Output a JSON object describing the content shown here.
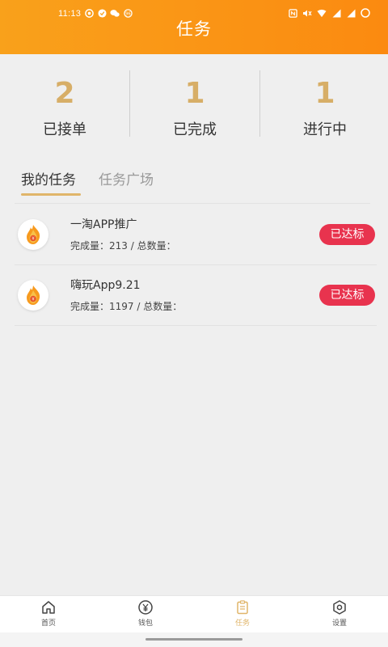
{
  "status_bar": {
    "time": "11:13",
    "left_icons": [
      "notification-app-icon",
      "shield-notification-icon",
      "wechat-icon",
      "app-badge-icon"
    ],
    "right_icons": [
      "nfc-icon",
      "mute-icon",
      "wifi-icon",
      "signal-icon",
      "signal-icon",
      "battery-icon"
    ]
  },
  "header": {
    "title": "任务",
    "gradient_start": "#f9a11b",
    "gradient_end": "#fb8a10"
  },
  "stats": [
    {
      "value": "2",
      "label": "已接单"
    },
    {
      "value": "1",
      "label": "已完成"
    },
    {
      "value": "1",
      "label": "进行中"
    }
  ],
  "tabs": [
    {
      "label": "我的任务",
      "active": true
    },
    {
      "label": "任务广场",
      "active": false
    }
  ],
  "tasks": [
    {
      "name": "一淘APP推广",
      "progress": "完成量：213 / 总数量：",
      "badge": "已达标",
      "icon": "flame-coin-icon"
    },
    {
      "name": "嗨玩App9.21",
      "progress": "完成量：1197 / 总数量：",
      "badge": "已达标",
      "icon": "flame-coin-icon"
    }
  ],
  "bottom_nav": [
    {
      "label": "首页",
      "icon": "home-icon",
      "active": false
    },
    {
      "label": "钱包",
      "icon": "wallet-icon",
      "active": false
    },
    {
      "label": "任务",
      "icon": "clipboard-icon",
      "active": true
    },
    {
      "label": "设置",
      "icon": "settings-icon",
      "active": false
    }
  ],
  "colors": {
    "accent_gold": "#d7ae67",
    "badge_red": "#e8334e",
    "background": "#efefef"
  }
}
